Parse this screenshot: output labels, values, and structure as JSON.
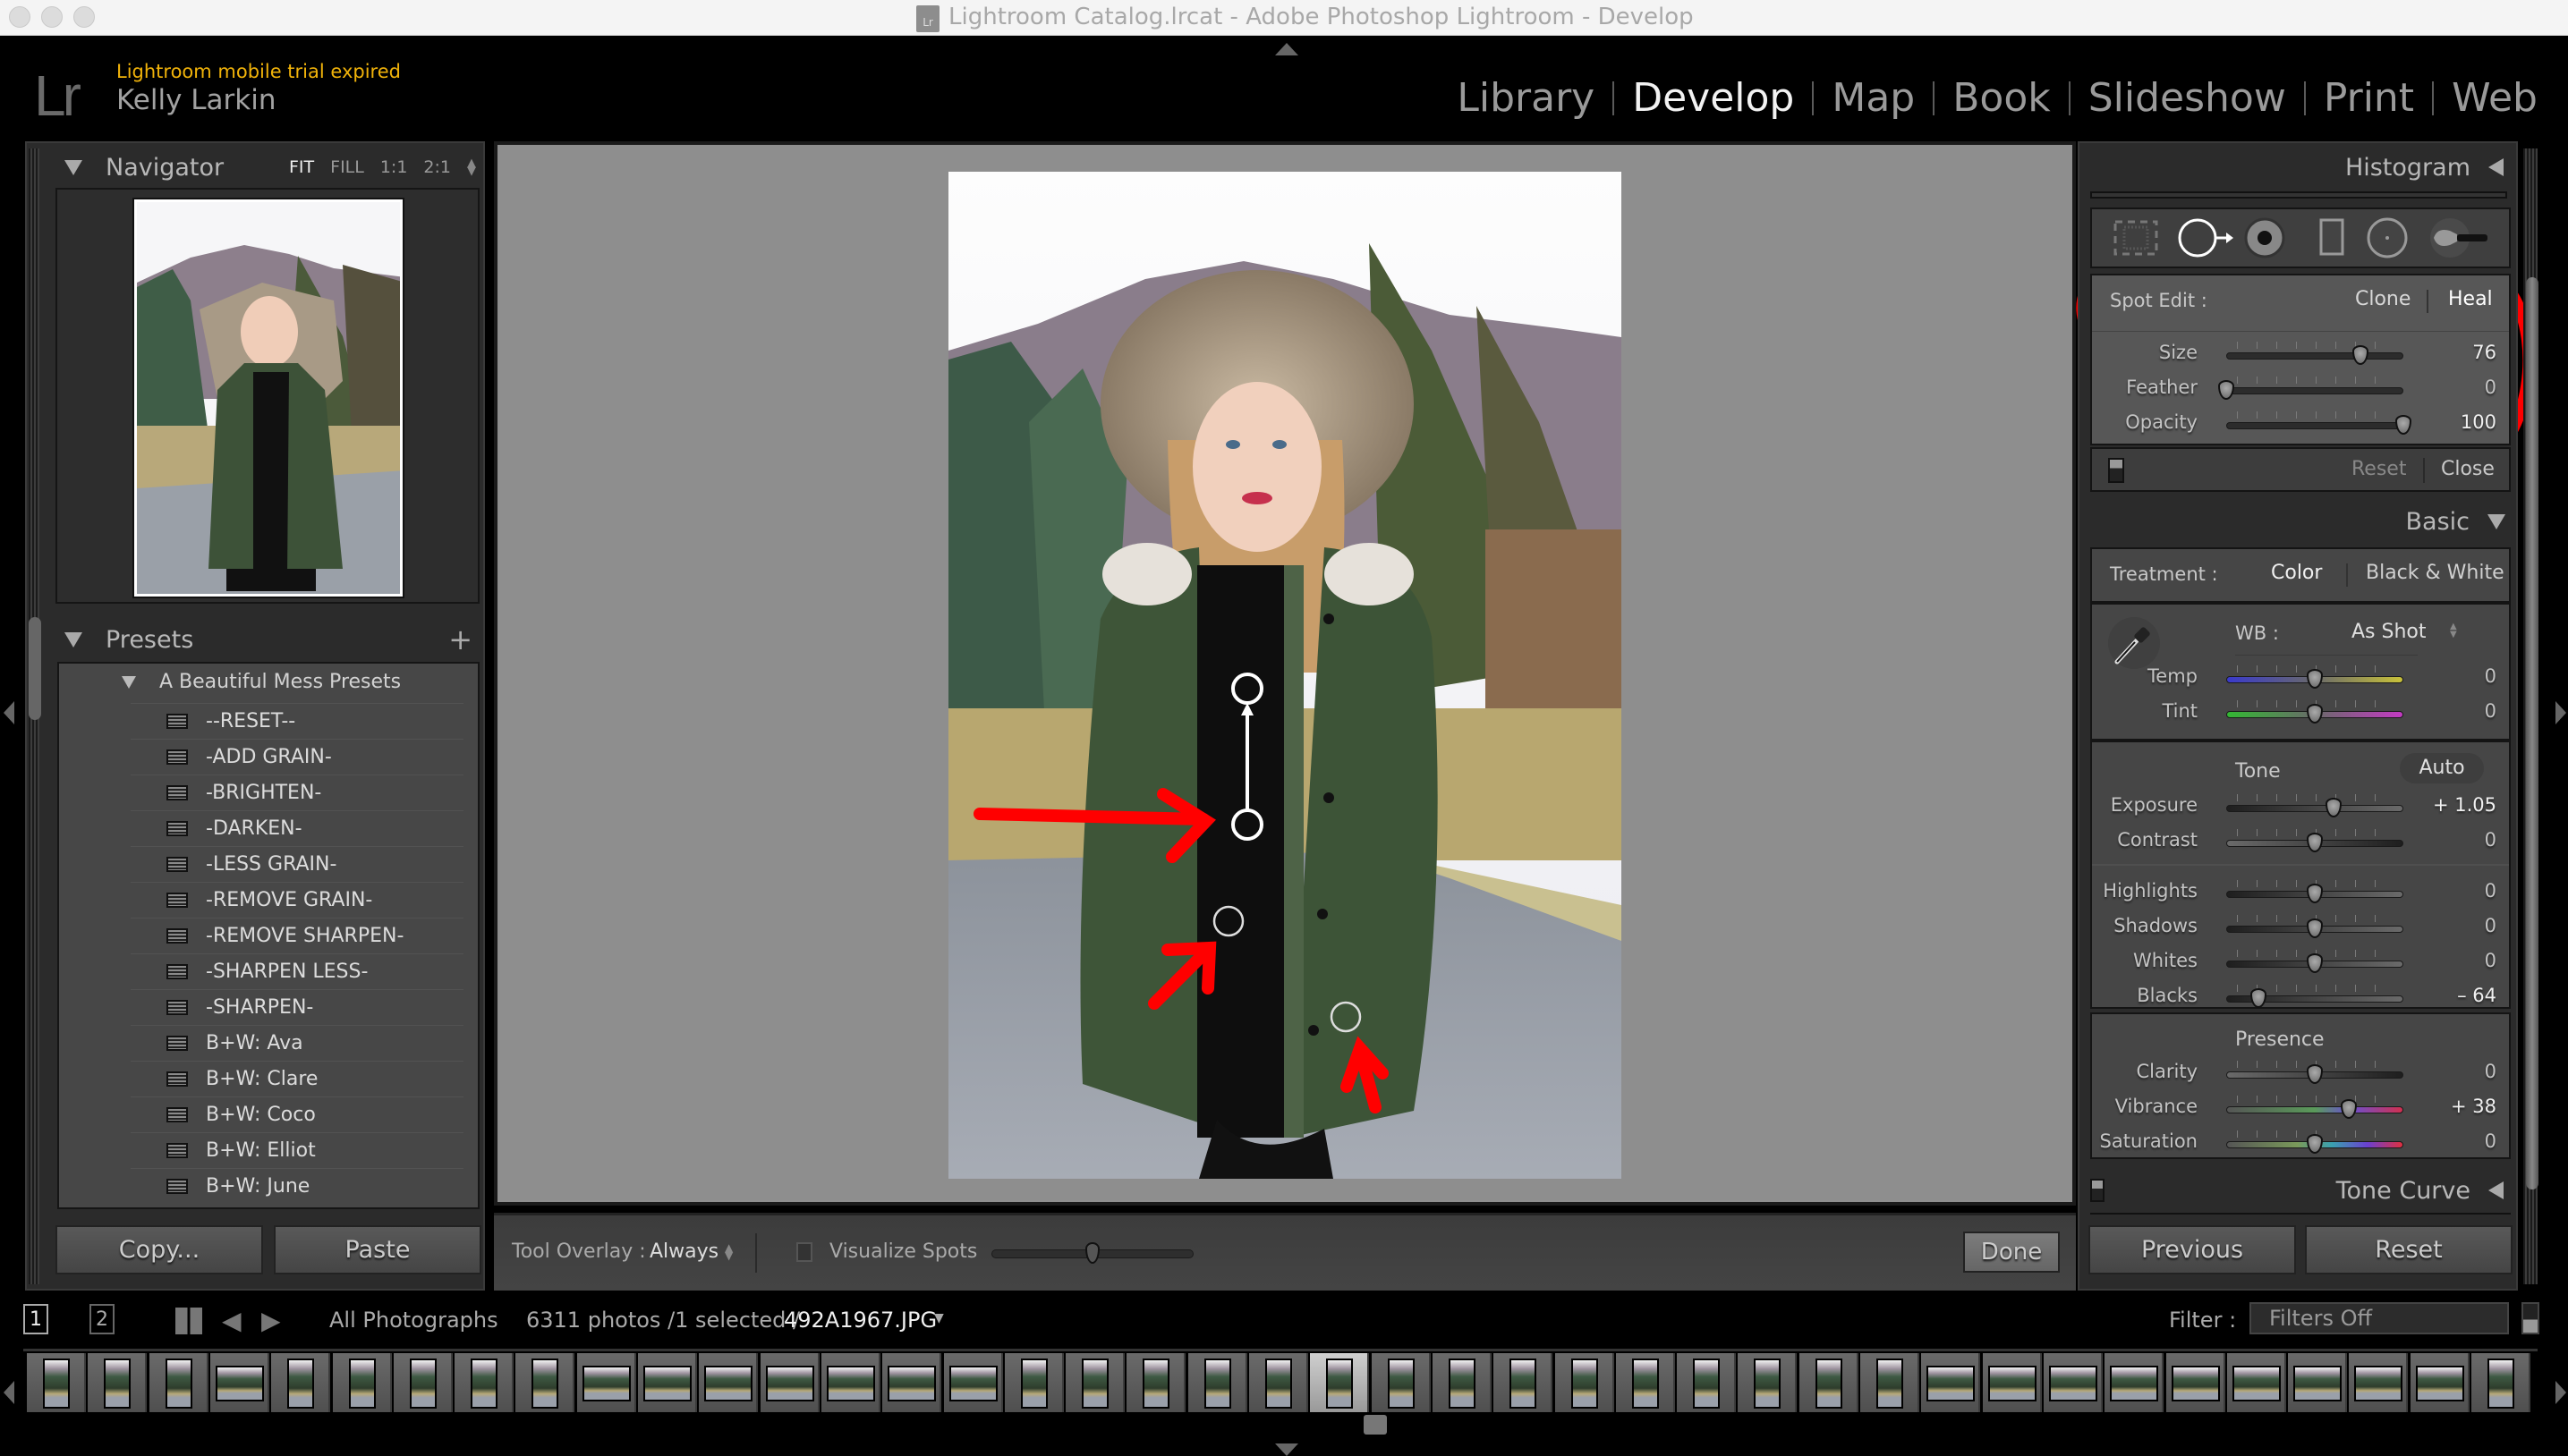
{
  "window": {
    "title": "Lightroom Catalog.lrcat - Adobe Photoshop Lightroom - Develop",
    "file_icon_label": "Lr"
  },
  "identity": {
    "logo": "Lr",
    "notice": "Lightroom mobile trial expired",
    "user": "Kelly Larkin",
    "notice_color": "#f1b30a"
  },
  "modules": [
    {
      "label": "Library",
      "active": false
    },
    {
      "label": "Develop",
      "active": true
    },
    {
      "label": "Map",
      "active": false
    },
    {
      "label": "Book",
      "active": false
    },
    {
      "label": "Slideshow",
      "active": false
    },
    {
      "label": "Print",
      "active": false
    },
    {
      "label": "Web",
      "active": false
    }
  ],
  "left_panel": {
    "navigator": {
      "title": "Navigator",
      "zoom_options": [
        "FIT",
        "FILL",
        "1:1",
        "2:1"
      ],
      "zoom_selected": "FIT"
    },
    "presets": {
      "title": "Presets",
      "add_icon": "plus-icon",
      "folder": "A Beautiful Mess Presets",
      "items": [
        "--RESET--",
        "-ADD GRAIN-",
        "-BRIGHTEN-",
        "-DARKEN-",
        "-LESS GRAIN-",
        "-REMOVE GRAIN-",
        "-REMOVE SHARPEN-",
        "-SHARPEN LESS-",
        "-SHARPEN-",
        "B+W: Ava",
        "B+W: Clare",
        "B+W: Coco",
        "B+W: Elliot",
        "B+W: June"
      ]
    },
    "copy_label": "Copy...",
    "paste_label": "Paste"
  },
  "toolbar": {
    "tool_overlay_label": "Tool Overlay :",
    "tool_overlay_value": "Always",
    "visualize_spots_label": "Visualize Spots",
    "visualize_spots_checked": false,
    "visualize_threshold": 0.5,
    "done_label": "Done"
  },
  "right_panel": {
    "histogram_title": "Histogram",
    "tools": [
      "crop-overlay",
      "spot-removal",
      "red-eye",
      "graduated-filter",
      "radial-filter",
      "adjustment-brush"
    ],
    "active_tool": "spot-removal",
    "spot_edit": {
      "label": "Spot Edit :",
      "modes": [
        "Clone",
        "Heal"
      ],
      "active_mode": "Heal",
      "sliders": [
        {
          "label": "Size",
          "value": "76",
          "fraction": 0.76
        },
        {
          "label": "Feather",
          "value": "0",
          "fraction": 0.0
        },
        {
          "label": "Opacity",
          "value": "100",
          "fraction": 1.0
        }
      ],
      "reset_label": "Reset",
      "close_label": "Close"
    },
    "basic": {
      "title": "Basic",
      "treatment_label": "Treatment :",
      "treatment_options": [
        "Color",
        "Black & White"
      ],
      "treatment_selected": "Color",
      "wb_label": "WB :",
      "wb_value": "As Shot",
      "wb_sliders": [
        {
          "label": "Temp",
          "value": "0",
          "fraction": 0.5
        },
        {
          "label": "Tint",
          "value": "0",
          "fraction": 0.5
        }
      ],
      "tone_label": "Tone",
      "auto_label": "Auto",
      "tone_sliders": [
        {
          "label": "Exposure",
          "value": "+ 1.05",
          "fraction": 0.605
        },
        {
          "label": "Contrast",
          "value": "0",
          "fraction": 0.5
        }
      ],
      "tone_sliders_2": [
        {
          "label": "Highlights",
          "value": "0",
          "fraction": 0.5
        },
        {
          "label": "Shadows",
          "value": "0",
          "fraction": 0.5
        },
        {
          "label": "Whites",
          "value": "0",
          "fraction": 0.5
        },
        {
          "label": "Blacks",
          "value": "– 64",
          "fraction": 0.18
        }
      ],
      "presence_label": "Presence",
      "presence_sliders": [
        {
          "label": "Clarity",
          "value": "0",
          "fraction": 0.5
        },
        {
          "label": "Vibrance",
          "value": "+ 38",
          "fraction": 0.69
        },
        {
          "label": "Saturation",
          "value": "0",
          "fraction": 0.5
        }
      ]
    },
    "tone_curve_title": "Tone Curve",
    "previous_label": "Previous",
    "reset_label": "Reset"
  },
  "filmstrip_bar": {
    "view1": "1",
    "view2": "2",
    "source": "All Photographs",
    "count_text": "6311 photos /1 selected /",
    "filename": "492A1967.JPG",
    "filter_label": "Filter :",
    "filter_value": "Filters Off"
  },
  "filmstrip": {
    "thumbnail_count": 41,
    "selected_index": 21
  },
  "colors": {
    "annotation_red": "#ff0000",
    "panel_bg": "#2b2b2b",
    "canvas_bg": "#8e8e8e"
  }
}
